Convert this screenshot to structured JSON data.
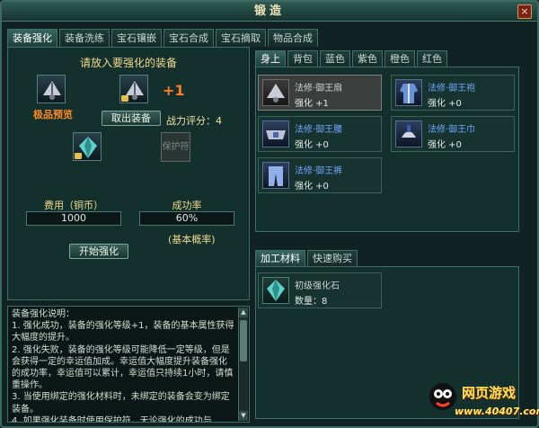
{
  "window": {
    "title": "锻造",
    "close_label": "×"
  },
  "main_tabs": [
    "装备强化",
    "装备洗练",
    "宝石镶嵌",
    "宝石合成",
    "宝石摘取",
    "物品合成"
  ],
  "enhance": {
    "prompt": "请放入要强化的装备",
    "plus_level": "+1",
    "preview_label": "极品预览",
    "takeout_button": "取出装备",
    "score_label": "战力评分：4",
    "protect_label": "保护符",
    "cost_label": "费用（铜币）",
    "cost_value": "1000",
    "rate_label": "成功率",
    "rate_value": "60%",
    "basic_rate_label": "(基本概率)",
    "start_button": "开始强化"
  },
  "description": {
    "text": "装备强化说明：\n1. 强化成功，装备的强化等级+1，装备的基本属性获得大幅度的提升。\n2. 强化失败，装备的强化等级可能降低一定等级，但是会获得一定的幸运值加成。幸运值大幅度提升装备强化的成功率，幸运值可以累计，幸运值只持续1小时，请慎重操作。\n3. 当使用绑定的强化材料时，未绑定的装备会变为绑定装备。\n4. 如果强化装备时使用保护符，无论强化的成功与",
    "scroll_up": "▲",
    "scroll_down": "▼"
  },
  "equip_tabs": [
    "身上",
    "背包",
    "蓝色",
    "紫色",
    "橙色",
    "红色"
  ],
  "equipment": [
    {
      "name": "法修·御王扇",
      "level": "强化 +1",
      "selected": true
    },
    {
      "name": "法修·御王袍",
      "level": "强化 +0",
      "selected": false
    },
    {
      "name": "法修·御王腰",
      "level": "强化 +0",
      "selected": false
    },
    {
      "name": "法修·御王巾",
      "level": "强化 +0",
      "selected": false
    },
    {
      "name": "法修·御王裤",
      "level": "强化 +0",
      "selected": false
    }
  ],
  "material_tabs": [
    "加工材料",
    "快速购买"
  ],
  "materials": [
    {
      "name": "初级强化石",
      "count": "数量：8"
    }
  ],
  "watermark": {
    "title": "网页游戏",
    "url": "www.40407.com"
  }
}
